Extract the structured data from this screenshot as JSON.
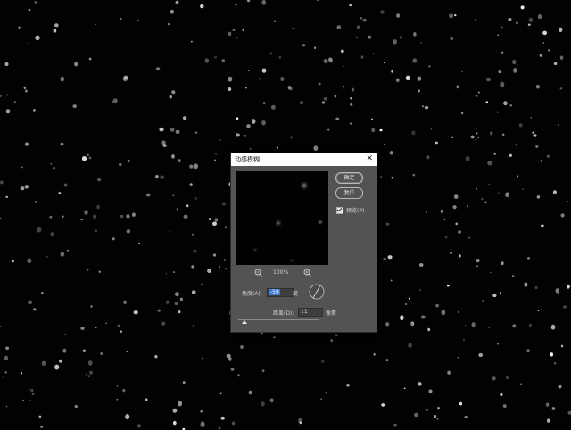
{
  "dialog": {
    "title": "动感模糊",
    "close_glyph": "✕",
    "ok_label": "确定",
    "reset_label": "复位",
    "preview_label": "预览(P)",
    "preview_checked": true,
    "zoom_percent": "100%",
    "angle_label": "角度(A):",
    "angle_value": "-59",
    "angle_unit": "度",
    "distance_label": "距离(D):",
    "distance_value": "11",
    "distance_unit": "像素"
  },
  "colors": {
    "dialog_bg": "#535353",
    "titlebar_bg": "#ffffff",
    "canvas_bg": "#020202",
    "selection": "#3a7bd5"
  },
  "icons": {
    "zoom_out": "zoom-out-icon",
    "zoom_in": "zoom-in-icon",
    "close": "close-icon",
    "angle_dial": "angle-dial-icon"
  }
}
